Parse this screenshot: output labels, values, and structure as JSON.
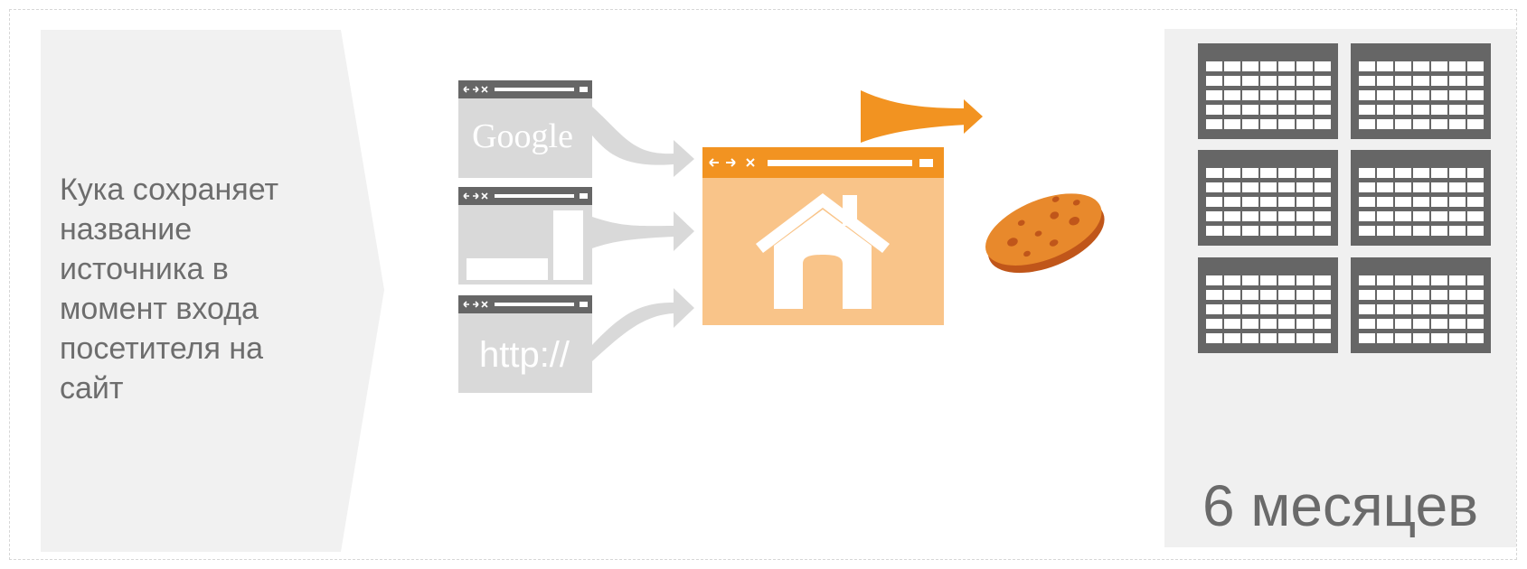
{
  "description_text": "Кука сохраняет\nназвание\nисточника в\nмомент входа\nпосетителя на\nсайт",
  "description_lines": [
    "Кука сохраняет",
    "название",
    "источника в",
    "момент входа",
    "посетителя на",
    "сайт"
  ],
  "sources": {
    "google_label": "Google",
    "url_label": "http://"
  },
  "duration_label": "6 месяцев",
  "colors": {
    "orange": "#f29321",
    "orange_light": "#f9c489",
    "gray_light": "#d9d9d9",
    "gray_dark": "#666666",
    "panel_bg": "#f0f0f0",
    "cookie": "#e8892c",
    "cookie_dark": "#c0561a"
  },
  "icons": [
    "browser-window-icon",
    "home-icon",
    "cookie-icon",
    "calendar-icon",
    "arrow-icon",
    "flag-arrow-icon"
  ]
}
